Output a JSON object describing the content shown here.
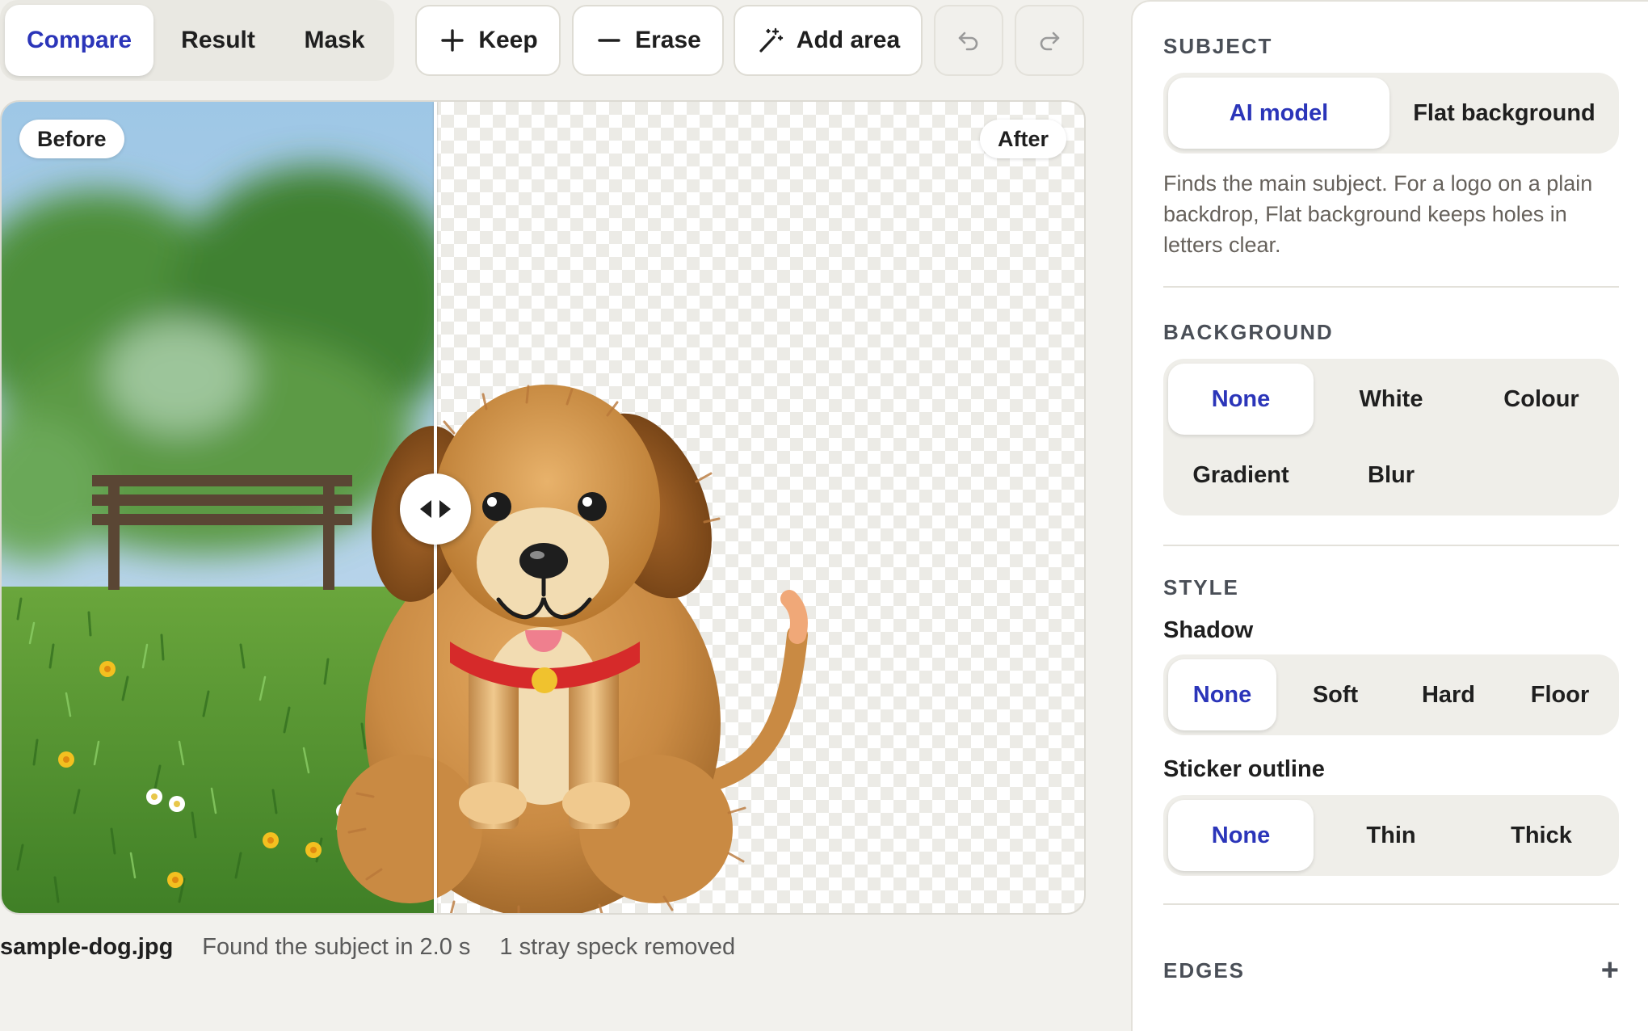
{
  "toolbar": {
    "views": [
      "Compare",
      "Result",
      "Mask"
    ],
    "active_view": "Compare",
    "keep_label": "Keep",
    "erase_label": "Erase",
    "add_area_label": "Add area",
    "icons": [
      "plus-icon",
      "minus-icon",
      "magic-wand-icon",
      "undo-icon",
      "redo-icon"
    ]
  },
  "canvas": {
    "before_label": "Before",
    "after_label": "After",
    "split_position": 0.4
  },
  "status": {
    "filename": "sample-dog.jpg",
    "message": "Found the subject in 2.0 s",
    "extra": "1 stray speck removed"
  },
  "panel": {
    "subject": {
      "title": "SUBJECT",
      "options": [
        "AI model",
        "Flat background"
      ],
      "selected": "AI model",
      "help": "Finds the main subject. For a logo on a plain backdrop, Flat background keeps holes in letters clear."
    },
    "background": {
      "title": "BACKGROUND",
      "options": [
        "None",
        "White",
        "Colour",
        "Gradient",
        "Blur"
      ],
      "selected": "None"
    },
    "style": {
      "title": "STYLE",
      "shadow_label": "Shadow",
      "shadow_options": [
        "None",
        "Soft",
        "Hard",
        "Floor"
      ],
      "shadow_selected": "None",
      "outline_label": "Sticker outline",
      "outline_options": [
        "None",
        "Thin",
        "Thick"
      ],
      "outline_selected": "None"
    },
    "edges": {
      "title": "EDGES",
      "expand_icon": "plus-icon"
    }
  },
  "colors": {
    "accent": "#2b35b9",
    "page_bg": "#f2f1ed",
    "panel_bg": "#ffffff"
  }
}
